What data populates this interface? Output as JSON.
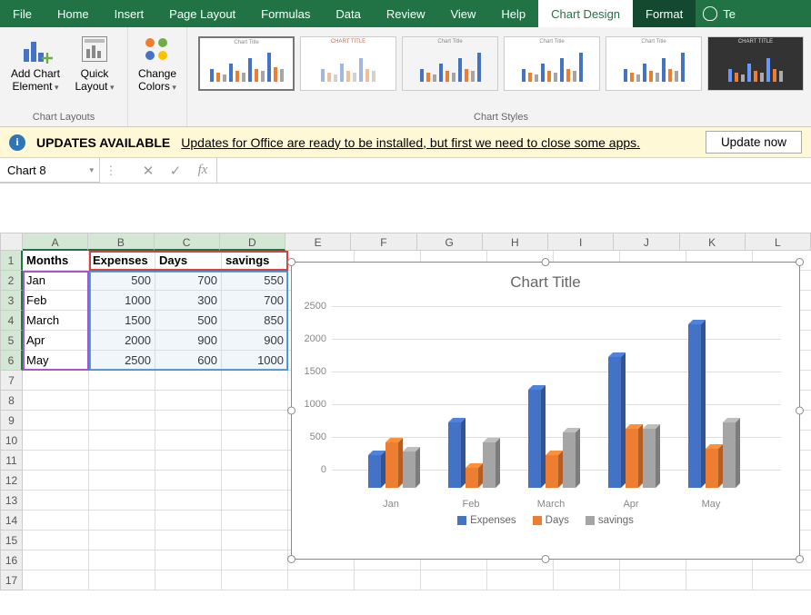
{
  "tabs": [
    "File",
    "Home",
    "Insert",
    "Page Layout",
    "Formulas",
    "Data",
    "Review",
    "View",
    "Help",
    "Chart Design",
    "Format"
  ],
  "active_tab": "Chart Design",
  "tell_me_prefix": "Te",
  "ribbon": {
    "add_chart_element": "Add Chart Element",
    "quick_layout": "Quick Layout",
    "change_colors": "Change Colors",
    "group_layouts": "Chart Layouts",
    "group_styles": "Chart Styles",
    "thumb_title": "Chart Title"
  },
  "msgbar": {
    "title": "UPDATES AVAILABLE",
    "text": "Updates for Office are ready to be installed, but first we need to close some apps.",
    "button": "Update now"
  },
  "namebox": "Chart 8",
  "fx_symbols": {
    "cancel": "✕",
    "enter": "✓",
    "fx": "fx"
  },
  "columns": [
    "A",
    "B",
    "C",
    "D",
    "E",
    "F",
    "G",
    "H",
    "I",
    "J",
    "K",
    "L"
  ],
  "rows": [
    "1",
    "2",
    "3",
    "4",
    "5",
    "6",
    "7",
    "8",
    "9",
    "10",
    "11",
    "12",
    "13",
    "14",
    "15",
    "16",
    "17"
  ],
  "table": {
    "headers": [
      "Months",
      "Expenses",
      "Days",
      "savings"
    ],
    "data": [
      [
        "Jan",
        500,
        700,
        550
      ],
      [
        "Feb",
        1000,
        300,
        700
      ],
      [
        "March",
        1500,
        500,
        850
      ],
      [
        "Apr",
        2000,
        900,
        900
      ],
      [
        "May",
        2500,
        600,
        1000
      ]
    ]
  },
  "chart_data": {
    "type": "bar",
    "title": "Chart Title",
    "categories": [
      "Jan",
      "Feb",
      "March",
      "Apr",
      "May"
    ],
    "series": [
      {
        "name": "Expenses",
        "values": [
          500,
          1000,
          1500,
          2000,
          2500
        ],
        "color": "#4472c4"
      },
      {
        "name": "Days",
        "values": [
          700,
          300,
          500,
          900,
          600
        ],
        "color": "#ed7d31"
      },
      {
        "name": "savings",
        "values": [
          550,
          700,
          850,
          900,
          1000
        ],
        "color": "#a5a5a5"
      }
    ],
    "ylim": [
      0,
      2500
    ],
    "y_ticks": [
      0,
      500,
      1000,
      1500,
      2000,
      2500
    ]
  }
}
